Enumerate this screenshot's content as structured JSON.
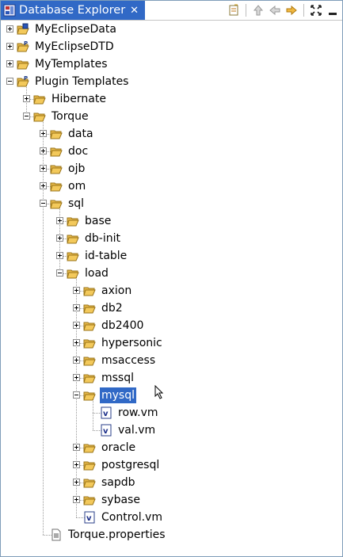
{
  "view": {
    "title": "Database Explorer",
    "close_symbol": "✕",
    "icon": "database-explorer-icon",
    "toolbar": [
      {
        "name": "collapse-all-button",
        "icon": "collapse-all-icon"
      },
      {
        "name": "go-up-button",
        "icon": "up-arrow-icon"
      },
      {
        "name": "back-button",
        "icon": "left-arrow-icon"
      },
      {
        "name": "forward-button",
        "icon": "right-arrow-icon"
      },
      {
        "name": "maximize-button",
        "icon": "maximize-icon"
      },
      {
        "name": "minimize-button",
        "icon": "minimize-icon"
      }
    ]
  },
  "colors": {
    "selection": "#3169c6",
    "folder": "#f3c95b"
  },
  "tree": [
    {
      "label": "MyEclipseData",
      "depth": 0,
      "expander": "plus",
      "icon": "project-folder-icon"
    },
    {
      "label": "MyEclipseDTD",
      "depth": 0,
      "expander": "plus",
      "icon": "plugin-folder-icon"
    },
    {
      "label": "MyTemplates",
      "depth": 0,
      "expander": "plus",
      "icon": "open-folder-icon"
    },
    {
      "label": "Plugin Templates",
      "depth": 0,
      "expander": "minus",
      "icon": "plugin-folder-icon"
    },
    {
      "label": "Hibernate",
      "depth": 1,
      "expander": "plus",
      "icon": "folder-icon"
    },
    {
      "label": "Torque",
      "depth": 1,
      "expander": "minus",
      "icon": "folder-icon"
    },
    {
      "label": "data",
      "depth": 2,
      "expander": "plus",
      "icon": "folder-icon"
    },
    {
      "label": "doc",
      "depth": 2,
      "expander": "plus",
      "icon": "folder-icon"
    },
    {
      "label": "ojb",
      "depth": 2,
      "expander": "plus",
      "icon": "folder-icon"
    },
    {
      "label": "om",
      "depth": 2,
      "expander": "plus",
      "icon": "folder-icon"
    },
    {
      "label": "sql",
      "depth": 2,
      "expander": "minus",
      "icon": "folder-icon"
    },
    {
      "label": "base",
      "depth": 3,
      "expander": "plus",
      "icon": "folder-icon"
    },
    {
      "label": "db-init",
      "depth": 3,
      "expander": "plus",
      "icon": "folder-icon"
    },
    {
      "label": "id-table",
      "depth": 3,
      "expander": "plus",
      "icon": "folder-icon"
    },
    {
      "label": "load",
      "depth": 3,
      "expander": "minus",
      "icon": "folder-icon"
    },
    {
      "label": "axion",
      "depth": 4,
      "expander": "plus",
      "icon": "folder-icon"
    },
    {
      "label": "db2",
      "depth": 4,
      "expander": "plus",
      "icon": "folder-icon"
    },
    {
      "label": "db2400",
      "depth": 4,
      "expander": "plus",
      "icon": "folder-icon"
    },
    {
      "label": "hypersonic",
      "depth": 4,
      "expander": "plus",
      "icon": "folder-icon"
    },
    {
      "label": "msaccess",
      "depth": 4,
      "expander": "plus",
      "icon": "folder-icon"
    },
    {
      "label": "mssql",
      "depth": 4,
      "expander": "plus",
      "icon": "folder-icon"
    },
    {
      "label": "mysql",
      "depth": 4,
      "expander": "minus",
      "icon": "folder-icon",
      "selected": true
    },
    {
      "label": "row.vm",
      "depth": 5,
      "expander": "none",
      "icon": "velocity-file-icon"
    },
    {
      "label": "val.vm",
      "depth": 5,
      "expander": "none",
      "icon": "velocity-file-icon"
    },
    {
      "label": "oracle",
      "depth": 4,
      "expander": "plus",
      "icon": "folder-icon"
    },
    {
      "label": "postgresql",
      "depth": 4,
      "expander": "plus",
      "icon": "folder-icon"
    },
    {
      "label": "sapdb",
      "depth": 4,
      "expander": "plus",
      "icon": "folder-icon"
    },
    {
      "label": "sybase",
      "depth": 4,
      "expander": "plus",
      "icon": "folder-icon"
    },
    {
      "label": "Control.vm",
      "depth": 4,
      "expander": "none",
      "icon": "velocity-file-icon"
    },
    {
      "label": "Torque.properties",
      "depth": 2,
      "expander": "none",
      "icon": "properties-file-icon"
    }
  ]
}
